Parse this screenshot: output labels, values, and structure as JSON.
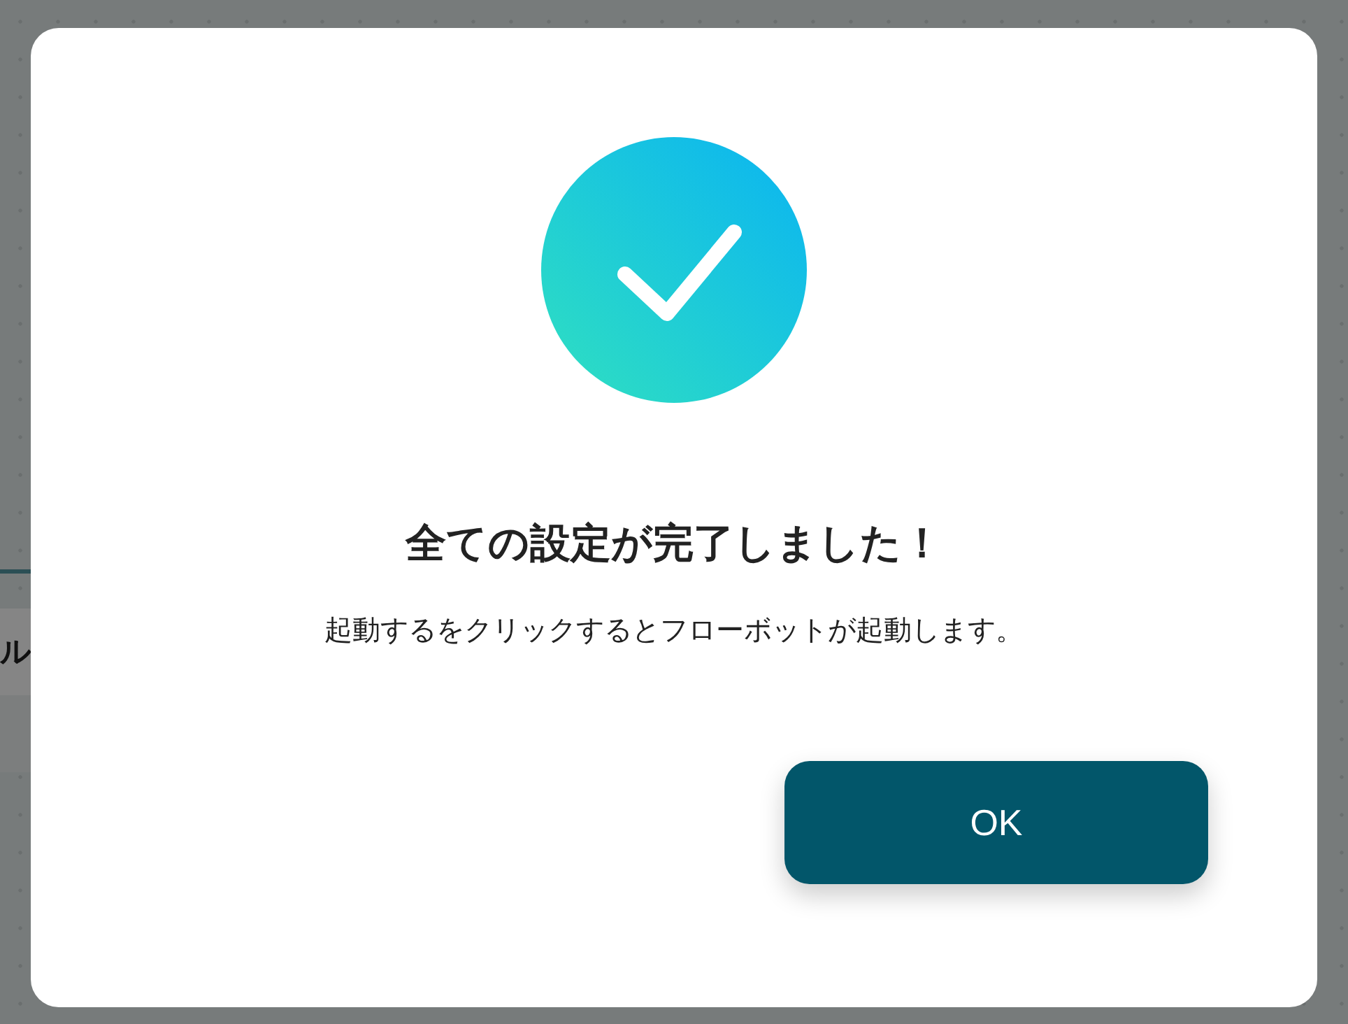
{
  "background": {
    "text": "ル"
  },
  "dialog": {
    "title": "全ての設定が完了しました！",
    "message": "起動するをクリックするとフローボットが起動します。",
    "button": "OK"
  }
}
